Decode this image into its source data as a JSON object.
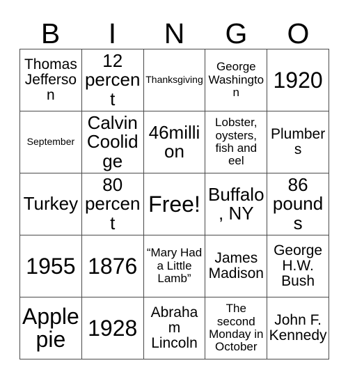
{
  "card": {
    "title_letters": [
      "B",
      "I",
      "N",
      "G",
      "O"
    ],
    "columns": 5,
    "rows": 5,
    "free_space_label": "Free!",
    "border_color": "#4a4a4a",
    "background_color": "#ffffff",
    "text_color": "#000000",
    "cells": [
      [
        {
          "text": "Thomas Jefferson",
          "size": "l"
        },
        {
          "text": "12 percent",
          "size": "xl"
        },
        {
          "text": "Thanksgiving",
          "size": "s"
        },
        {
          "text": "George Washington",
          "size": "m"
        },
        {
          "text": "1920",
          "size": "xxl"
        }
      ],
      [
        {
          "text": "September",
          "size": "s"
        },
        {
          "text": "Calvin Coolidge",
          "size": "xl"
        },
        {
          "text": "46million",
          "size": "xl"
        },
        {
          "text": "Lobster, oysters, fish and eel",
          "size": "m"
        },
        {
          "text": "Plumbers",
          "size": "l"
        }
      ],
      [
        {
          "text": "Turkey",
          "size": "xl"
        },
        {
          "text": "80 percent",
          "size": "xl"
        },
        {
          "text": "Free!",
          "size": "xxl"
        },
        {
          "text": "Buffalo, NY",
          "size": "xl"
        },
        {
          "text": "86 pounds",
          "size": "xl"
        }
      ],
      [
        {
          "text": "1955",
          "size": "xxl"
        },
        {
          "text": "1876",
          "size": "xxl"
        },
        {
          "text": "“Mary Had a Little Lamb”",
          "size": "m"
        },
        {
          "text": "James Madison",
          "size": "l"
        },
        {
          "text": "George H.W. Bush",
          "size": "l"
        }
      ],
      [
        {
          "text": "Apple pie",
          "size": "xxl"
        },
        {
          "text": "1928",
          "size": "xxl"
        },
        {
          "text": "Abraham Lincoln",
          "size": "l"
        },
        {
          "text": "The second Monday in October",
          "size": "m"
        },
        {
          "text": "John F. Kennedy",
          "size": "l"
        }
      ]
    ]
  }
}
